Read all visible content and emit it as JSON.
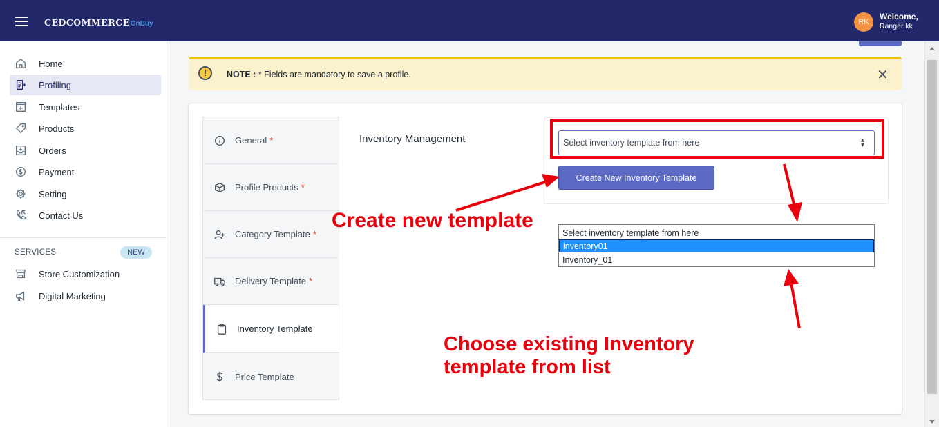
{
  "header": {
    "brand": "CEDCOMMERCE",
    "brand_sub": "OnBuy",
    "avatar_initials": "RK",
    "welcome": "Welcome,",
    "user_name": "Ranger kk"
  },
  "sidebar": {
    "items": [
      {
        "label": "Home",
        "icon": "home-icon"
      },
      {
        "label": "Profiling",
        "icon": "profiling-icon",
        "active": true
      },
      {
        "label": "Templates",
        "icon": "templates-icon"
      },
      {
        "label": "Products",
        "icon": "tag-icon"
      },
      {
        "label": "Orders",
        "icon": "orders-icon"
      },
      {
        "label": "Payment",
        "icon": "dollar-icon"
      },
      {
        "label": "Setting",
        "icon": "gear-icon"
      },
      {
        "label": "Contact Us",
        "icon": "phone-icon"
      }
    ],
    "services_label": "SERVICES",
    "new_badge": "NEW",
    "services": [
      {
        "label": "Store Customization",
        "icon": "store-icon"
      },
      {
        "label": "Digital Marketing",
        "icon": "megaphone-icon"
      }
    ]
  },
  "note": {
    "label": "NOTE :",
    "text": " * Fields are mandatory to save a profile.",
    "close": "✕"
  },
  "tabs": [
    {
      "label": "General",
      "required": "*",
      "icon": "info-icon"
    },
    {
      "label": "Profile Products",
      "required": "*",
      "icon": "box-icon"
    },
    {
      "label": "Category Template",
      "required": "*",
      "icon": "user-plus-icon"
    },
    {
      "label": "Delivery Template",
      "required": "*",
      "icon": "truck-icon"
    },
    {
      "label": "Inventory Template",
      "required": "",
      "icon": "clipboard-icon",
      "active": true
    },
    {
      "label": "Price Template",
      "required": "",
      "icon": "dollar-sign-icon"
    }
  ],
  "form": {
    "field_label": "Inventory Management",
    "select_value": "Select inventory template from here",
    "create_button": "Create New Inventory Template"
  },
  "dropdown": {
    "options": [
      "Select inventory template from here",
      "inventory01",
      "Inventory_01"
    ],
    "selected_index": 1
  },
  "annotations": {
    "create": "Create new template",
    "choose_line1": "Choose existing Inventory",
    "choose_line2": "template from list",
    "color": "#e8000d"
  },
  "colors": {
    "topbar": "#23286b",
    "accent": "#5c6ac4",
    "note_bg": "#fcf1cd"
  }
}
